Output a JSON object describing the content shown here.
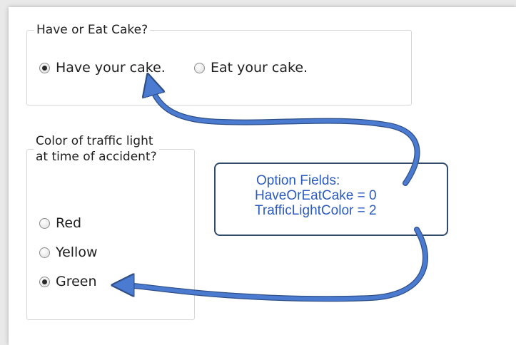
{
  "colors": {
    "arrow": "#4a7bd0",
    "arrow_outline": "#2f4f86",
    "callout_text": "#2c5bbf",
    "callout_border": "#2f4a6b",
    "group_border": "#d6d6d6"
  },
  "cake_group": {
    "legend": "Have or Eat Cake?",
    "options": [
      {
        "label": "Have your cake.",
        "checked": true
      },
      {
        "label": "Eat your cake.",
        "checked": false
      }
    ]
  },
  "light_group": {
    "legend_line1": "Color of traffic light",
    "legend_line2": "at time of accident?",
    "options": [
      {
        "label": "Red",
        "checked": false
      },
      {
        "label": "Yellow",
        "checked": false
      },
      {
        "label": "Green",
        "checked": true
      }
    ]
  },
  "callout": {
    "title": "Option Fields:",
    "line2": "HaveOrEatCake = 0",
    "line3": "TrafficLightColor = 2"
  }
}
